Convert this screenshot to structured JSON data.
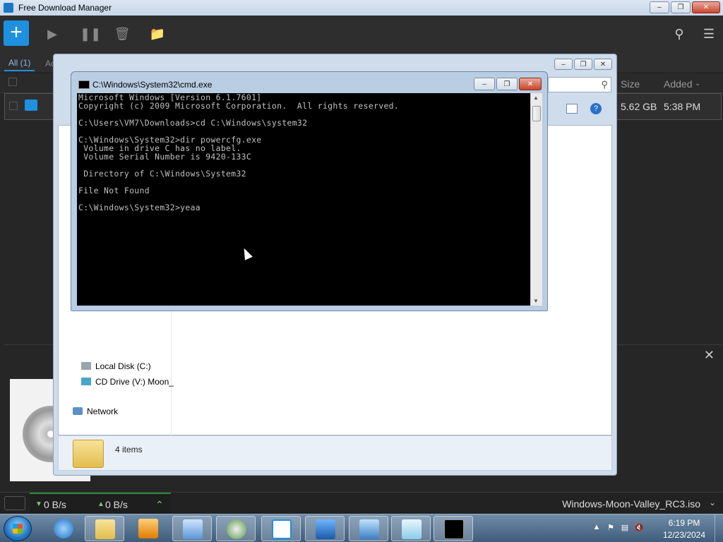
{
  "fdm": {
    "title": "Free Download Manager",
    "add_label": "+",
    "tabs": {
      "all": "All (1)",
      "active": "Ac"
    },
    "columns": {
      "size": "Size",
      "added": "Added"
    },
    "row": {
      "size": "5.62 GB",
      "added": "5:38 PM"
    },
    "status": {
      "down": "0 B/s",
      "up": "0 B/s",
      "file": "Windows-Moon-Valley_RC3.iso"
    }
  },
  "explorer": {
    "nav": {
      "local_disk": "Local Disk (C:)",
      "cd_drive": "CD Drive (V:) Moon_",
      "network": "Network"
    },
    "items_count": "4 items"
  },
  "cmd": {
    "title": "C:\\Windows\\System32\\cmd.exe",
    "lines": [
      "Microsoft Windows [Version 6.1.7601]",
      "Copyright (c) 2009 Microsoft Corporation.  All rights reserved.",
      "",
      "C:\\Users\\VM7\\Downloads>cd C:\\Windows\\system32",
      "",
      "C:\\Windows\\System32>dir powercfg.exe",
      " Volume in drive C has no label.",
      " Volume Serial Number is 9420-133C",
      "",
      " Directory of C:\\Windows\\System32",
      "",
      "File Not Found",
      "",
      "C:\\Windows\\System32>yeaa"
    ]
  },
  "taskbar": {
    "time": "6:19 PM",
    "date": "12/23/2024"
  },
  "colors": {
    "accent": "#1e90e0",
    "console_bg": "#000000",
    "console_text": "#c0c0c0"
  }
}
